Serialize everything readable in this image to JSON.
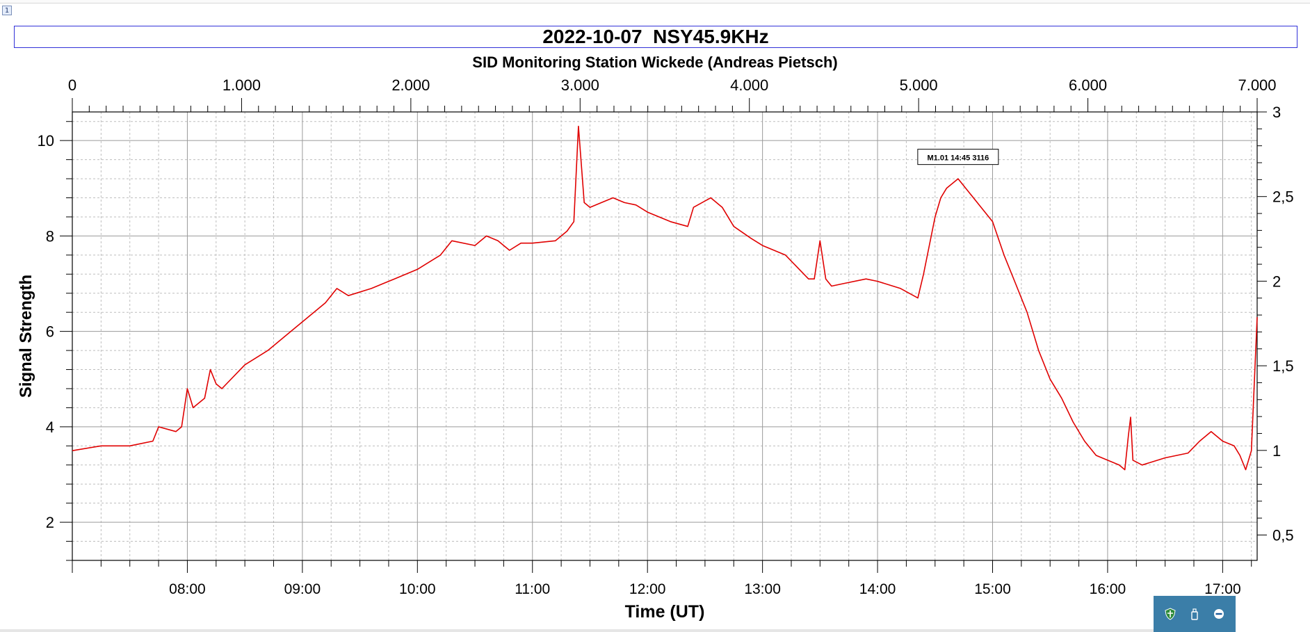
{
  "window": {
    "tab_number": "1"
  },
  "chart_data": {
    "type": "line",
    "title": "2022-10-07  NSY45.9KHz",
    "subtitle": "SID Monitoring Station Wickede (Andreas Pietsch)",
    "xlabel": "Time (UT)",
    "ylabel": "Signal Strength",
    "x_unit": "hours UT",
    "xlim": [
      7.0,
      17.3
    ],
    "ylim": [
      1.2,
      10.6
    ],
    "y2lim": [
      0.35,
      3.0
    ],
    "top_axis_lim": [
      0,
      7000
    ],
    "x_ticks": [
      8,
      9,
      10,
      11,
      12,
      13,
      14,
      15,
      16,
      17
    ],
    "x_tick_labels": [
      "08:00",
      "09:00",
      "10:00",
      "11:00",
      "12:00",
      "13:00",
      "14:00",
      "15:00",
      "16:00",
      "17:00"
    ],
    "y_ticks": [
      2,
      4,
      6,
      8,
      10
    ],
    "y_tick_labels": [
      "2",
      "4",
      "6",
      "8",
      "10"
    ],
    "y2_ticks": [
      0.5,
      1,
      1.5,
      2,
      2.5,
      3
    ],
    "y2_tick_labels": [
      "0,5",
      "1",
      "1,5",
      "2",
      "2,5",
      "3"
    ],
    "top_ticks": [
      0,
      1000,
      2000,
      3000,
      4000,
      5000,
      6000,
      7000
    ],
    "top_tick_labels": [
      "0",
      "1.000",
      "2.000",
      "3.000",
      "4.000",
      "5.000",
      "6.000",
      "7.000"
    ],
    "grid": true,
    "line_color": "#e00000",
    "series": [
      {
        "x": [
          7.0,
          7.25,
          7.5,
          7.7,
          7.75,
          7.9,
          7.95,
          8.0,
          8.05,
          8.15,
          8.2,
          8.25,
          8.3,
          8.5,
          8.7,
          8.9,
          9.1,
          9.2,
          9.3,
          9.4,
          9.6,
          9.7,
          9.8,
          10.0,
          10.2,
          10.3,
          10.5,
          10.6,
          10.7,
          10.8,
          10.9,
          11.0,
          11.2,
          11.3,
          11.36,
          11.4,
          11.45,
          11.5,
          11.6,
          11.7,
          11.8,
          11.9,
          12.0,
          12.2,
          12.35,
          12.4,
          12.55,
          12.65,
          12.75,
          12.9,
          13.0,
          13.2,
          13.4,
          13.45,
          13.5,
          13.55,
          13.6,
          13.7,
          13.9,
          14.0,
          14.2,
          14.35,
          14.4,
          14.45,
          14.5,
          14.55,
          14.6,
          14.7,
          14.8,
          14.9,
          15.0,
          15.1,
          15.2,
          15.3,
          15.4,
          15.5,
          15.6,
          15.7,
          15.8,
          15.9,
          16.0,
          16.1,
          16.15,
          16.18,
          16.2,
          16.22,
          16.3,
          16.5,
          16.7,
          16.8,
          16.9,
          17.0,
          17.1,
          17.15,
          17.2,
          17.25,
          17.3
        ],
        "y": [
          3.5,
          3.6,
          3.6,
          3.7,
          4.0,
          3.9,
          4.0,
          4.8,
          4.4,
          4.6,
          5.2,
          4.9,
          4.8,
          5.3,
          5.6,
          6.0,
          6.4,
          6.6,
          6.9,
          6.75,
          6.9,
          7.0,
          7.1,
          7.3,
          7.6,
          7.9,
          7.8,
          8.0,
          7.9,
          7.7,
          7.85,
          7.85,
          7.9,
          8.1,
          8.3,
          10.3,
          8.7,
          8.6,
          8.7,
          8.8,
          8.7,
          8.65,
          8.5,
          8.3,
          8.2,
          8.6,
          8.8,
          8.6,
          8.2,
          7.95,
          7.8,
          7.6,
          7.1,
          7.1,
          7.9,
          7.1,
          6.95,
          7.0,
          7.1,
          7.05,
          6.9,
          6.7,
          7.2,
          7.8,
          8.4,
          8.8,
          9.0,
          9.2,
          8.9,
          8.6,
          8.3,
          7.6,
          7.0,
          6.4,
          5.6,
          5.0,
          4.6,
          4.1,
          3.7,
          3.4,
          3.3,
          3.2,
          3.1,
          3.8,
          4.2,
          3.3,
          3.2,
          3.35,
          3.45,
          3.7,
          3.9,
          3.7,
          3.6,
          3.4,
          3.1,
          3.5,
          6.3
        ]
      }
    ],
    "annotations": [
      {
        "text": "M1.01 14:45 3116",
        "x": 14.7,
        "y": 9.25
      }
    ]
  }
}
